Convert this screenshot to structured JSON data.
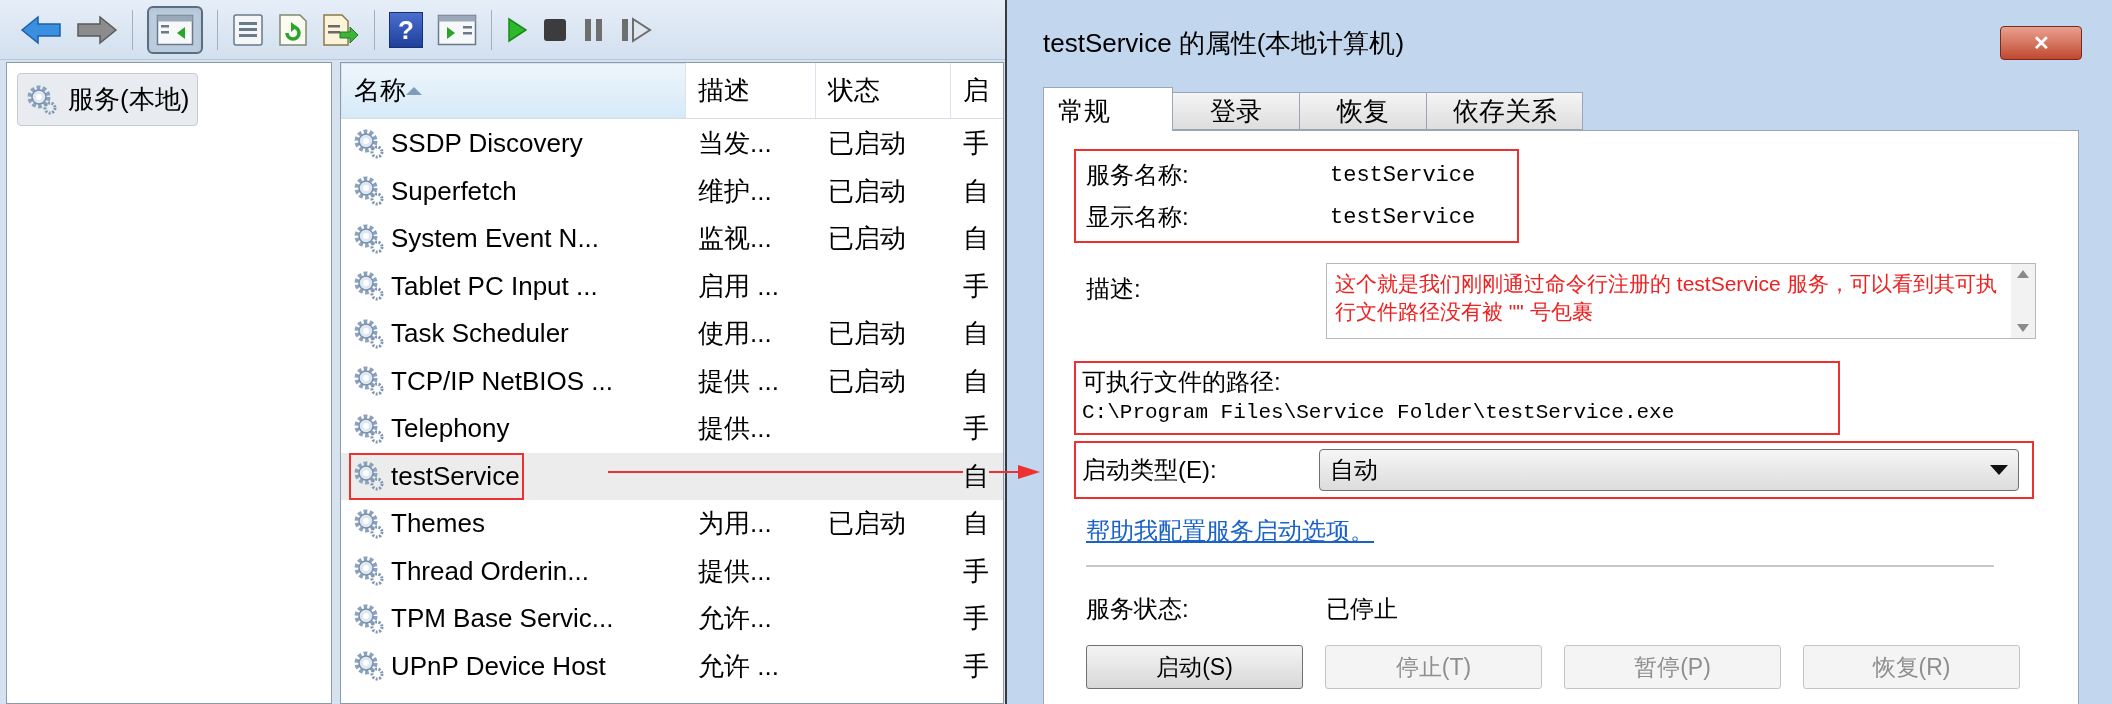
{
  "toolbar": [
    {
      "kind": "back"
    },
    {
      "kind": "forward"
    },
    {
      "kind": "separator"
    },
    {
      "kind": "console-tree",
      "pressed": true
    },
    {
      "kind": "separator"
    },
    {
      "kind": "properties"
    },
    {
      "kind": "refresh"
    },
    {
      "kind": "export"
    },
    {
      "kind": "separator"
    },
    {
      "kind": "help",
      "glyph": "?"
    },
    {
      "kind": "action-pane"
    },
    {
      "kind": "separator"
    },
    {
      "kind": "start"
    },
    {
      "kind": "stop"
    },
    {
      "kind": "pause"
    },
    {
      "kind": "resume"
    }
  ],
  "tree": {
    "items": [
      {
        "label": "服务(本地)",
        "selected": true
      }
    ]
  },
  "list": {
    "columns": [
      {
        "label": "名称",
        "sorted": true
      },
      {
        "label": "描述",
        "sorted": false
      },
      {
        "label": "状态",
        "sorted": false
      },
      {
        "label": "启",
        "sorted": false
      }
    ],
    "rows": [
      {
        "name": "SSDP Discovery",
        "description": "当发...",
        "status": "已启动",
        "startup": "手",
        "selected": false,
        "annotated": false
      },
      {
        "name": "Superfetch",
        "description": "维护...",
        "status": "已启动",
        "startup": "自",
        "selected": false,
        "annotated": false
      },
      {
        "name": "System Event N...",
        "description": "监视...",
        "status": "已启动",
        "startup": "自",
        "selected": false,
        "annotated": false
      },
      {
        "name": "Tablet PC Input ...",
        "description": "启用 ...",
        "startup": "手",
        "selected": false,
        "annotated": false
      },
      {
        "name": "Task Scheduler",
        "description": "使用...",
        "status": "已启动",
        "startup": "自",
        "selected": false,
        "annotated": false
      },
      {
        "name": "TCP/IP NetBIOS ...",
        "description": "提供 ...",
        "status": "已启动",
        "startup": "自",
        "selected": false,
        "annotated": false
      },
      {
        "name": "Telephony",
        "description": "提供...",
        "startup": "手",
        "selected": false,
        "annotated": false
      },
      {
        "name": "testService",
        "startup": "自",
        "selected": true,
        "annotated": true
      },
      {
        "name": "Themes",
        "description": "为用...",
        "status": "已启动",
        "startup": "自",
        "selected": false,
        "annotated": false
      },
      {
        "name": "Thread Orderin...",
        "description": "提供...",
        "startup": "手",
        "selected": false,
        "annotated": false
      },
      {
        "name": "TPM Base Servic...",
        "description": "允许...",
        "startup": "手",
        "selected": false,
        "annotated": false
      },
      {
        "name": "UPnP Device Host",
        "description": "允许 ...",
        "startup": "手",
        "selected": false,
        "annotated": false
      }
    ]
  },
  "dialog": {
    "title": "testService 的属性(本地计算机)",
    "close": "✕",
    "tabs": [
      {
        "label": "常规",
        "selected": true
      },
      {
        "label": "登录",
        "selected": false
      },
      {
        "label": "恢复",
        "selected": false
      },
      {
        "label": "依存关系",
        "selected": false
      }
    ],
    "names": {
      "annotated": true,
      "fields": [
        {
          "label": "服务名称:",
          "value": "testService"
        },
        {
          "label": "显示名称:",
          "value": "testService"
        }
      ]
    },
    "description": {
      "label": "描述:",
      "value": "这个就是我们刚刚通过命令行注册的 testService 服务，可以看到其可执行文件路径没有被 \"\" 号包裹"
    },
    "path": {
      "label": "可执行文件的路径:",
      "value": "C:\\Program Files\\Service Folder\\testService.exe",
      "annotated": true
    },
    "startup_type": {
      "label": "启动类型(E):",
      "value": "自动",
      "annotated": true
    },
    "help_link": "帮助我配置服务启动选项。",
    "service_status": {
      "label": "服务状态:",
      "value": "已停止"
    },
    "buttons": [
      {
        "label": "启动(S)",
        "disabled": false
      },
      {
        "label": "停止(T)",
        "disabled": true
      },
      {
        "label": "暂停(P)",
        "disabled": true
      },
      {
        "label": "恢复(R)",
        "disabled": true
      }
    ]
  }
}
